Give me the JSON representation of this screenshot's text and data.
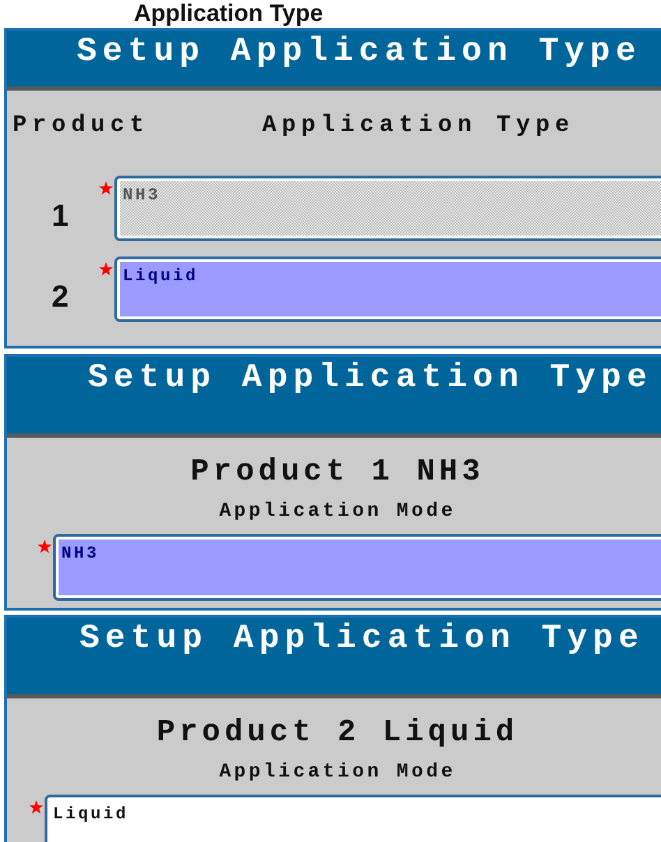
{
  "top_heading": "Application Type",
  "screens": [
    {
      "kind": "table",
      "title": "Setup Application Type",
      "columns": [
        "Product",
        "Application Type"
      ],
      "rows": [
        {
          "number": "1",
          "value": "NH3",
          "required": true,
          "disabled": true,
          "selected": false
        },
        {
          "number": "2",
          "value": "Liquid",
          "required": true,
          "disabled": false,
          "selected": true
        }
      ]
    },
    {
      "kind": "detail",
      "title": "Setup Application Type",
      "heading": "Product 1 NH3",
      "label": "Application Mode",
      "field": {
        "value": "NH3",
        "required": true,
        "disabled": false,
        "selected": true
      }
    },
    {
      "kind": "detail",
      "title": "Setup Application Type",
      "heading": "Product 2 Liquid",
      "label": "Application Mode",
      "field": {
        "value": "Liquid",
        "required": true,
        "disabled": false,
        "selected": false
      }
    }
  ]
}
